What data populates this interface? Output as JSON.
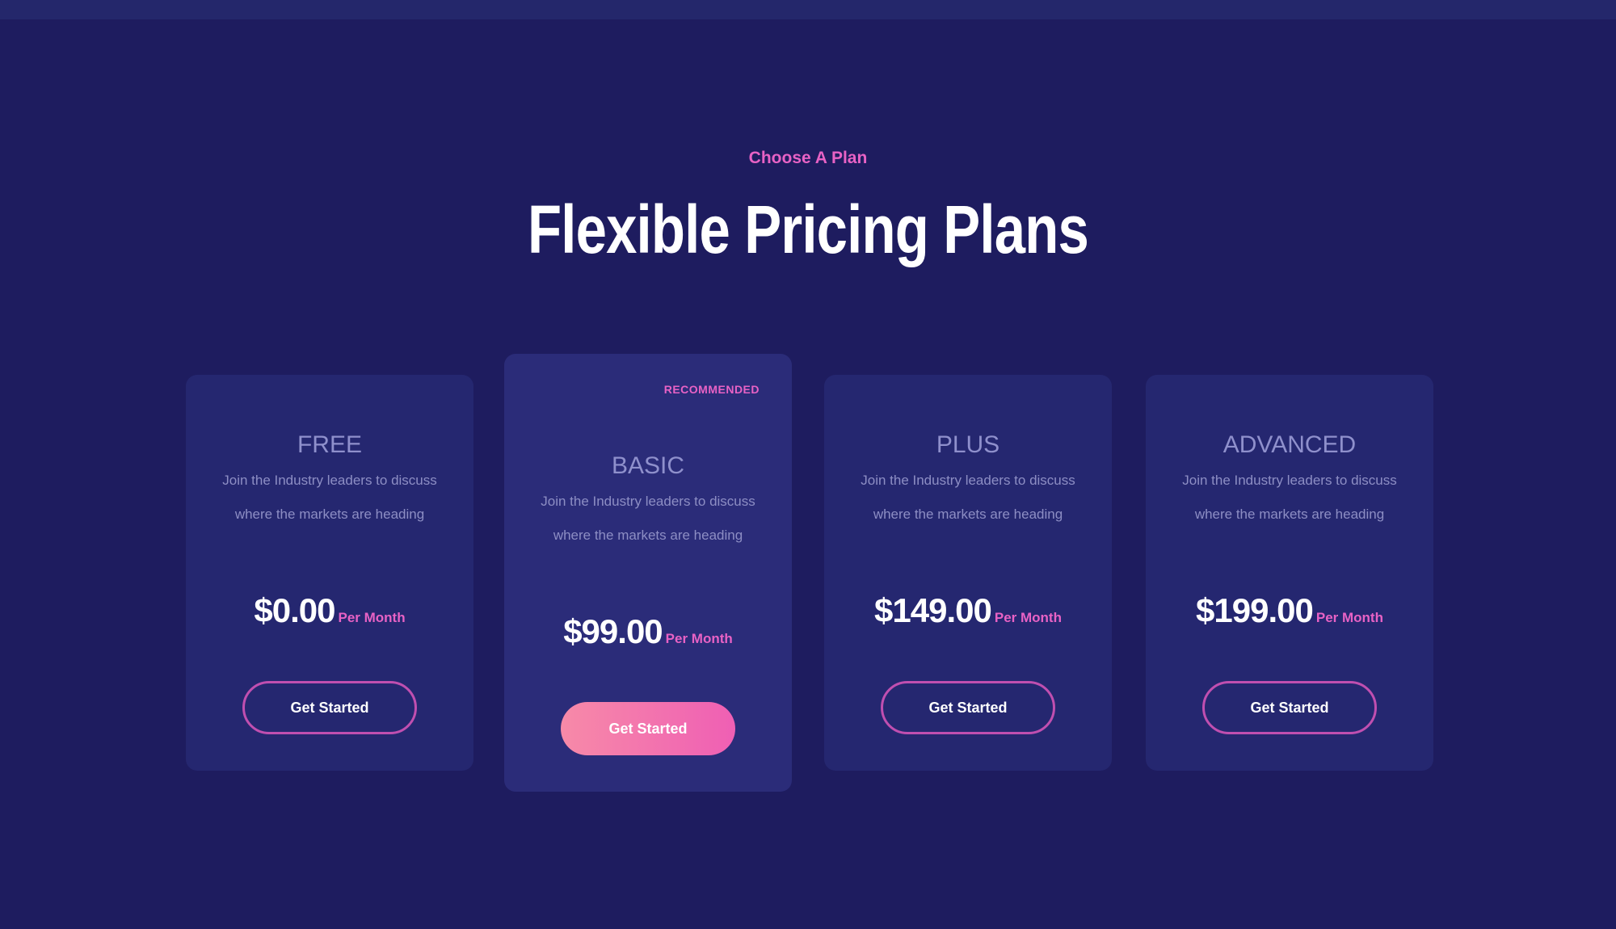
{
  "section": {
    "eyebrow": "Choose A Plan",
    "title": "Flexible Pricing Plans"
  },
  "plans": [
    {
      "name": "FREE",
      "description": "Join the Industry leaders to discuss where the markets are heading",
      "price": "$0.00",
      "period": "Per Month",
      "button": "Get Started",
      "recommended": ""
    },
    {
      "name": "BASIC",
      "description": "Join the Industry leaders to discuss where the markets are heading",
      "price": "$99.00",
      "period": "Per Month",
      "button": "Get Started",
      "recommended": "RECOMMENDED"
    },
    {
      "name": "PLUS",
      "description": "Join the Industry leaders to discuss where the markets are heading",
      "price": "$149.00",
      "period": "Per Month",
      "button": "Get Started",
      "recommended": ""
    },
    {
      "name": "ADVANCED",
      "description": "Join the Industry leaders to discuss where the markets are heading",
      "price": "$199.00",
      "period": "Per Month",
      "button": "Get Started",
      "recommended": ""
    }
  ],
  "colors": {
    "background": "#1e1c5f",
    "card": "#252770",
    "accent": "#e862c5",
    "button_gradient_start": "#f78aa8",
    "button_gradient_end": "#ef5fb4"
  }
}
